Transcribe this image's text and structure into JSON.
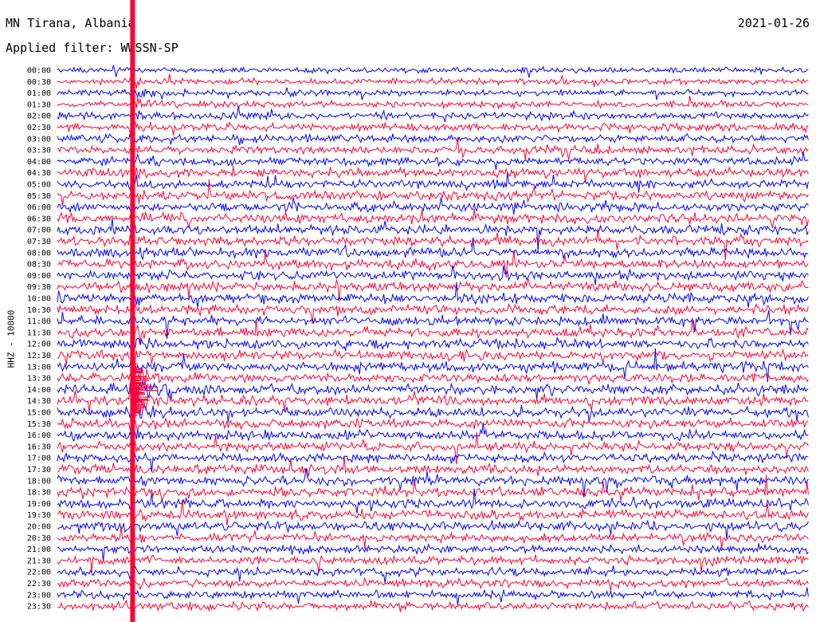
{
  "header": {
    "title": "MN Tirana, Albania",
    "date": "2021-01-26",
    "filter": "Applied filter: WWSSN-SP",
    "channel_label": "HHZ - 10000"
  },
  "colors": {
    "trace_a": "#0000ff",
    "trace_b": "#ff0033",
    "event_marker": "#ff0033",
    "background": "#ffffff"
  },
  "chart_data": {
    "type": "line",
    "title": "MN Tirana, Albania",
    "subtitle": "Applied filter: WWSSN-SP",
    "date": "2021-01-26",
    "ylabel": "HHZ - 10000",
    "xlabel": "",
    "row_labels": [
      "00:00",
      "00:30",
      "01:00",
      "01:30",
      "02:00",
      "02:30",
      "03:00",
      "03:30",
      "04:00",
      "04:30",
      "05:00",
      "05:30",
      "06:00",
      "06:30",
      "07:00",
      "07:30",
      "08:00",
      "08:30",
      "09:00",
      "09:30",
      "10:00",
      "10:30",
      "11:00",
      "11:30",
      "12:00",
      "12:30",
      "13:00",
      "13:30",
      "14:00",
      "14:30",
      "15:00",
      "15:30",
      "16:00",
      "16:30",
      "17:00",
      "17:30",
      "18:00",
      "18:30",
      "19:00",
      "19:30",
      "20:00",
      "20:30",
      "21:00",
      "21:30",
      "22:00",
      "22:30",
      "23:00",
      "23:30"
    ],
    "row_minutes": 30,
    "trace_colors": [
      "#0000ff",
      "#ff0033"
    ],
    "event": {
      "minute_offset": 3,
      "start_row": "00:00",
      "peak_rows": [
        "13:30",
        "14:00",
        "14:30"
      ]
    },
    "grid": false
  }
}
